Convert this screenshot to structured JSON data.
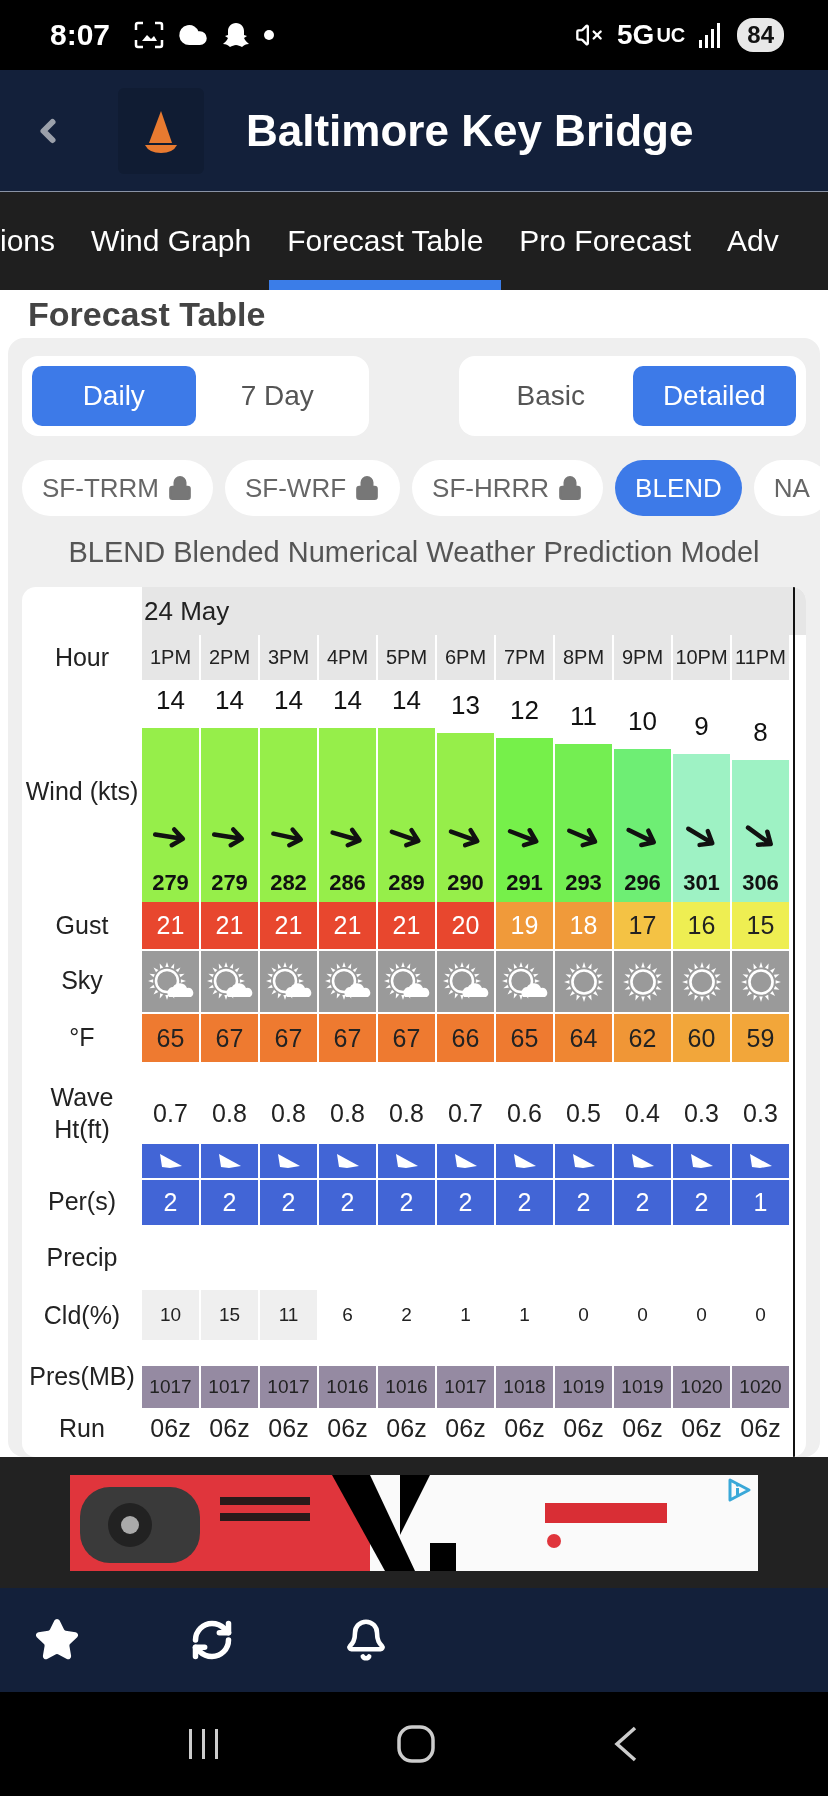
{
  "status_bar": {
    "time": "8:07",
    "network": "5G",
    "network_suffix": "UC",
    "battery": "84"
  },
  "header": {
    "title": "Baltimore Key Bridge"
  },
  "tabs": [
    {
      "label": "ions",
      "selected": false
    },
    {
      "label": "Wind Graph",
      "selected": false
    },
    {
      "label": "Forecast Table",
      "selected": true
    },
    {
      "label": "Pro Forecast",
      "selected": false
    },
    {
      "label": "Adv",
      "selected": false
    }
  ],
  "heading": "Forecast Table",
  "range_toggle": [
    {
      "label": "Daily",
      "selected": true
    },
    {
      "label": "7 Day",
      "selected": false
    }
  ],
  "detail_toggle": [
    {
      "label": "Basic",
      "selected": false
    },
    {
      "label": "Detailed",
      "selected": true
    }
  ],
  "models": [
    {
      "label": "SF-TRRM",
      "locked": true,
      "selected": false
    },
    {
      "label": "SF-WRF",
      "locked": true,
      "selected": false
    },
    {
      "label": "SF-HRRR",
      "locked": true,
      "selected": false
    },
    {
      "label": "BLEND",
      "locked": false,
      "selected": true
    },
    {
      "label": "NA",
      "locked": false,
      "selected": false
    }
  ],
  "model_description": "BLEND Blended Numerical Weather Prediction Model",
  "table": {
    "date": "24 May",
    "labels": {
      "hour": "Hour",
      "wind": "Wind (kts)",
      "gust": "Gust",
      "sky": "Sky",
      "temp": "°F",
      "wave": "Wave Ht(ft)",
      "period": "Per(s)",
      "precip": "Precip",
      "cloud": "Cld(%)",
      "pressure": "Pres(MB)",
      "run": "Run"
    },
    "hours": [
      {
        "hour": "1PM",
        "wind": {
          "speed": "14",
          "direction": "279",
          "color": "#96ee4a"
        },
        "gust": {
          "value": "21",
          "color": "#e8472e"
        },
        "sky": {
          "kind": "partly_cloudy"
        },
        "temp": {
          "value": "65",
          "color": "#ee7a30"
        },
        "wave": "0.7",
        "period": "2",
        "cloud": "10",
        "cloud_shaded": true,
        "pressure": "1017",
        "run": "06z"
      },
      {
        "hour": "2PM",
        "wind": {
          "speed": "14",
          "direction": "279",
          "color": "#96ee4a"
        },
        "gust": {
          "value": "21",
          "color": "#e8472e"
        },
        "sky": {
          "kind": "partly_cloudy"
        },
        "temp": {
          "value": "67",
          "color": "#ee7a30"
        },
        "wave": "0.8",
        "period": "2",
        "cloud": "15",
        "cloud_shaded": true,
        "pressure": "1017",
        "run": "06z"
      },
      {
        "hour": "3PM",
        "wind": {
          "speed": "14",
          "direction": "282",
          "color": "#96ee4a"
        },
        "gust": {
          "value": "21",
          "color": "#e8472e"
        },
        "sky": {
          "kind": "partly_cloudy"
        },
        "temp": {
          "value": "67",
          "color": "#ee7a30"
        },
        "wave": "0.8",
        "period": "2",
        "cloud": "11",
        "cloud_shaded": true,
        "pressure": "1017",
        "run": "06z"
      },
      {
        "hour": "4PM",
        "wind": {
          "speed": "14",
          "direction": "286",
          "color": "#96ee4a"
        },
        "gust": {
          "value": "21",
          "color": "#e8472e"
        },
        "sky": {
          "kind": "partly_cloudy"
        },
        "temp": {
          "value": "67",
          "color": "#ee7a30"
        },
        "wave": "0.8",
        "period": "2",
        "cloud": "6",
        "cloud_shaded": false,
        "pressure": "1016",
        "run": "06z"
      },
      {
        "hour": "5PM",
        "wind": {
          "speed": "14",
          "direction": "289",
          "color": "#96ee4a"
        },
        "gust": {
          "value": "21",
          "color": "#e8472e"
        },
        "sky": {
          "kind": "partly_cloudy"
        },
        "temp": {
          "value": "67",
          "color": "#ee7a30"
        },
        "wave": "0.8",
        "period": "2",
        "cloud": "2",
        "cloud_shaded": false,
        "pressure": "1016",
        "run": "06z"
      },
      {
        "hour": "6PM",
        "wind": {
          "speed": "13",
          "direction": "290",
          "color": "#96ee4a"
        },
        "gust": {
          "value": "20",
          "color": "#e8472e"
        },
        "sky": {
          "kind": "partly_cloudy"
        },
        "temp": {
          "value": "66",
          "color": "#ee7a30"
        },
        "wave": "0.7",
        "period": "2",
        "cloud": "1",
        "cloud_shaded": false,
        "pressure": "1017",
        "run": "06z"
      },
      {
        "hour": "7PM",
        "wind": {
          "speed": "12",
          "direction": "291",
          "color": "#76f04a"
        },
        "gust": {
          "value": "19",
          "color": "#f09a3a"
        },
        "sky": {
          "kind": "partly_cloudy"
        },
        "temp": {
          "value": "65",
          "color": "#ee7a30"
        },
        "wave": "0.6",
        "period": "2",
        "cloud": "1",
        "cloud_shaded": false,
        "pressure": "1018",
        "run": "06z"
      },
      {
        "hour": "8PM",
        "wind": {
          "speed": "11",
          "direction": "293",
          "color": "#74ee52"
        },
        "gust": {
          "value": "18",
          "color": "#f09a3a"
        },
        "sky": {
          "kind": "clear"
        },
        "temp": {
          "value": "64",
          "color": "#ef8632"
        },
        "wave": "0.5",
        "period": "2",
        "cloud": "0",
        "cloud_shaded": false,
        "pressure": "1019",
        "run": "06z"
      },
      {
        "hour": "9PM",
        "wind": {
          "speed": "10",
          "direction": "296",
          "color": "#6eee74"
        },
        "gust": {
          "value": "17",
          "color": "#f4c244"
        },
        "sky": {
          "kind": "clear"
        },
        "temp": {
          "value": "62",
          "color": "#f09636"
        },
        "wave": "0.4",
        "period": "2",
        "cloud": "0",
        "cloud_shaded": false,
        "pressure": "1019",
        "run": "06z"
      },
      {
        "hour": "10PM",
        "wind": {
          "speed": "9",
          "direction": "301",
          "color": "#9ef2c4"
        },
        "gust": {
          "value": "16",
          "color": "#eeee52"
        },
        "sky": {
          "kind": "clear"
        },
        "temp": {
          "value": "60",
          "color": "#f2a63a"
        },
        "wave": "0.3",
        "period": "2",
        "cloud": "0",
        "cloud_shaded": false,
        "pressure": "1020",
        "run": "06z"
      },
      {
        "hour": "11PM",
        "wind": {
          "speed": "8",
          "direction": "306",
          "color": "#9ef2c4"
        },
        "gust": {
          "value": "15",
          "color": "#eeee52"
        },
        "sky": {
          "kind": "clear"
        },
        "temp": {
          "value": "59",
          "color": "#f2a63a"
        },
        "wave": "0.3",
        "period": "1",
        "cloud": "0",
        "cloud_shaded": false,
        "pressure": "1020",
        "run": "06z"
      }
    ]
  }
}
